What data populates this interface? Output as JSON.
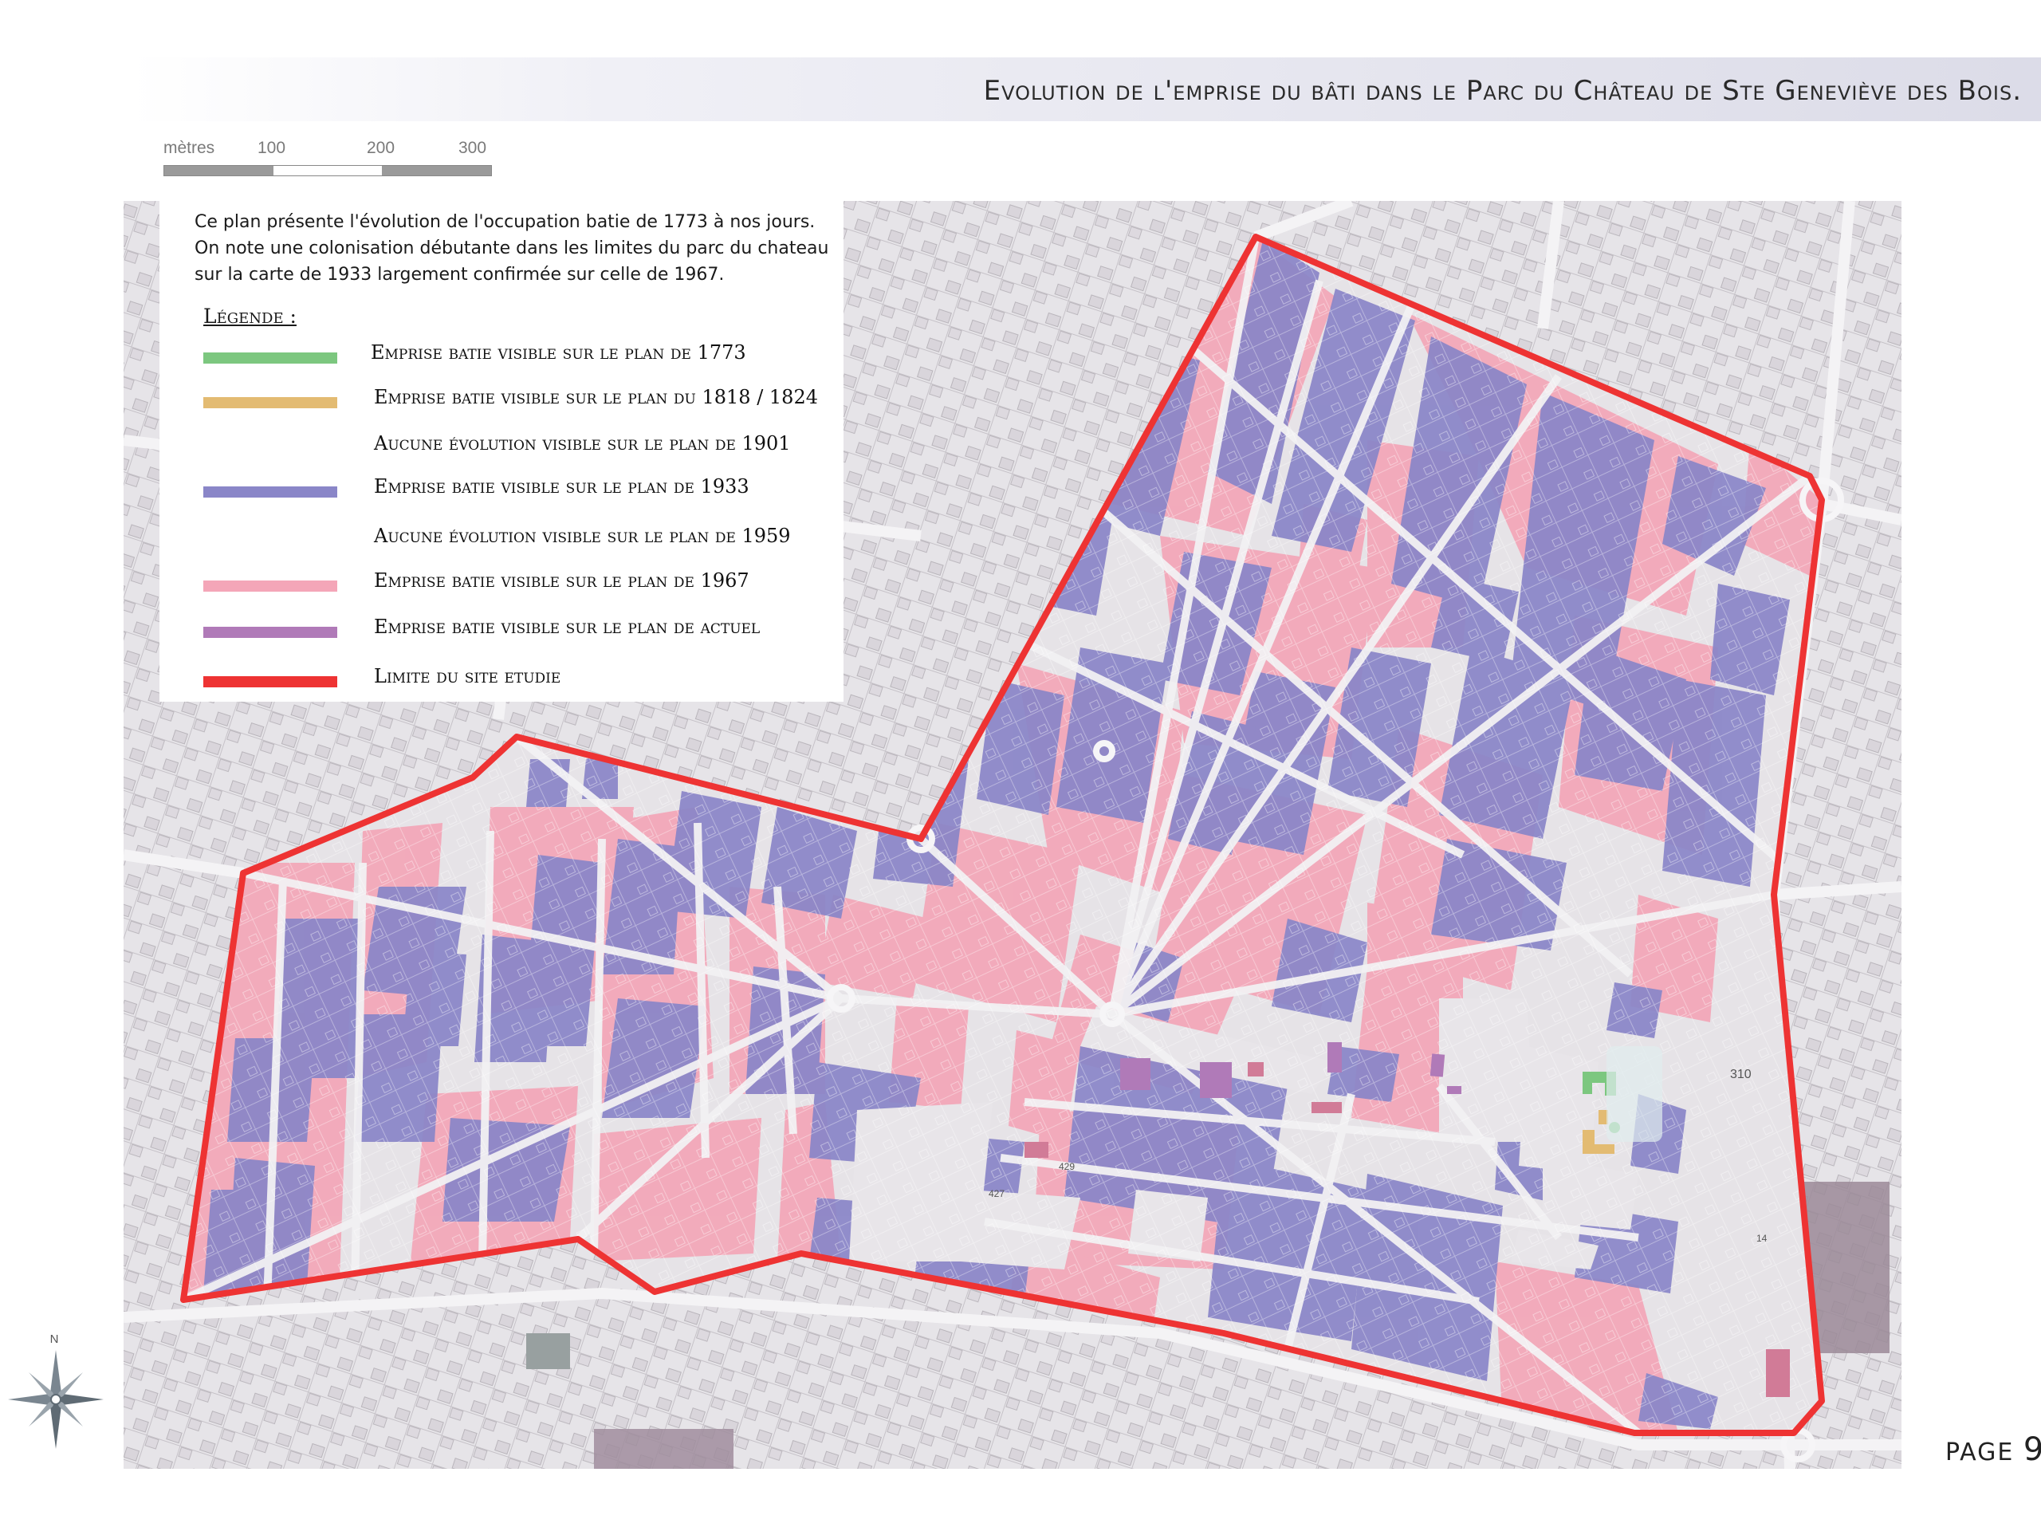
{
  "title": "Evolution de l'emprise du bâti dans le Parc du Château de Ste Geneviève des Bois.",
  "scale": {
    "unit_label": "mètres",
    "ticks": [
      "100",
      "200",
      "300"
    ]
  },
  "intro_text": "Ce plan présente l'évolution de l'occupation batie de 1773 à nos jours. On note une colonisation débutante dans les limites du parc du chateau sur la carte de 1933 largement confirmée sur celle de 1967.",
  "legend": {
    "title": "Légende :",
    "items": [
      {
        "label": "Emprise batie visible sur le plan de 1773",
        "color": "#7cc77f"
      },
      {
        "label": "Emprise batie visible sur le plan du 1818 / 1824",
        "color": "#e3bb72"
      },
      {
        "label": "Aucune évolution visible sur le plan de 1901",
        "color": ""
      },
      {
        "label": "Emprise batie visible sur le plan de 1933",
        "color": "#8a86c8"
      },
      {
        "label": "Aucune évolution visible sur le plan de 1959",
        "color": ""
      },
      {
        "label": "Emprise batie visible sur le plan de 1967",
        "color": "#f4a6b8"
      },
      {
        "label": "Emprise batie visible sur le plan de actuel",
        "color": "#b07ab8"
      },
      {
        "label": "Limite du site etudie",
        "color": "#ee3333"
      }
    ]
  },
  "map_labels": {
    "parcel_310": "310",
    "parcel_429": "429",
    "parcel_427": "427",
    "parcel_14": "14"
  },
  "compass_label": "N",
  "page": {
    "prefix": "PAGE",
    "number": "9"
  },
  "colors": {
    "blue_1933": "#8a86c8",
    "pink_1967": "#f4a6b8",
    "purple_actuel": "#b07ab8",
    "green_1773": "#7cc77f",
    "orange_1818": "#e3bb72",
    "boundary": "#ee3333",
    "map_background": "#e9e7ea"
  }
}
